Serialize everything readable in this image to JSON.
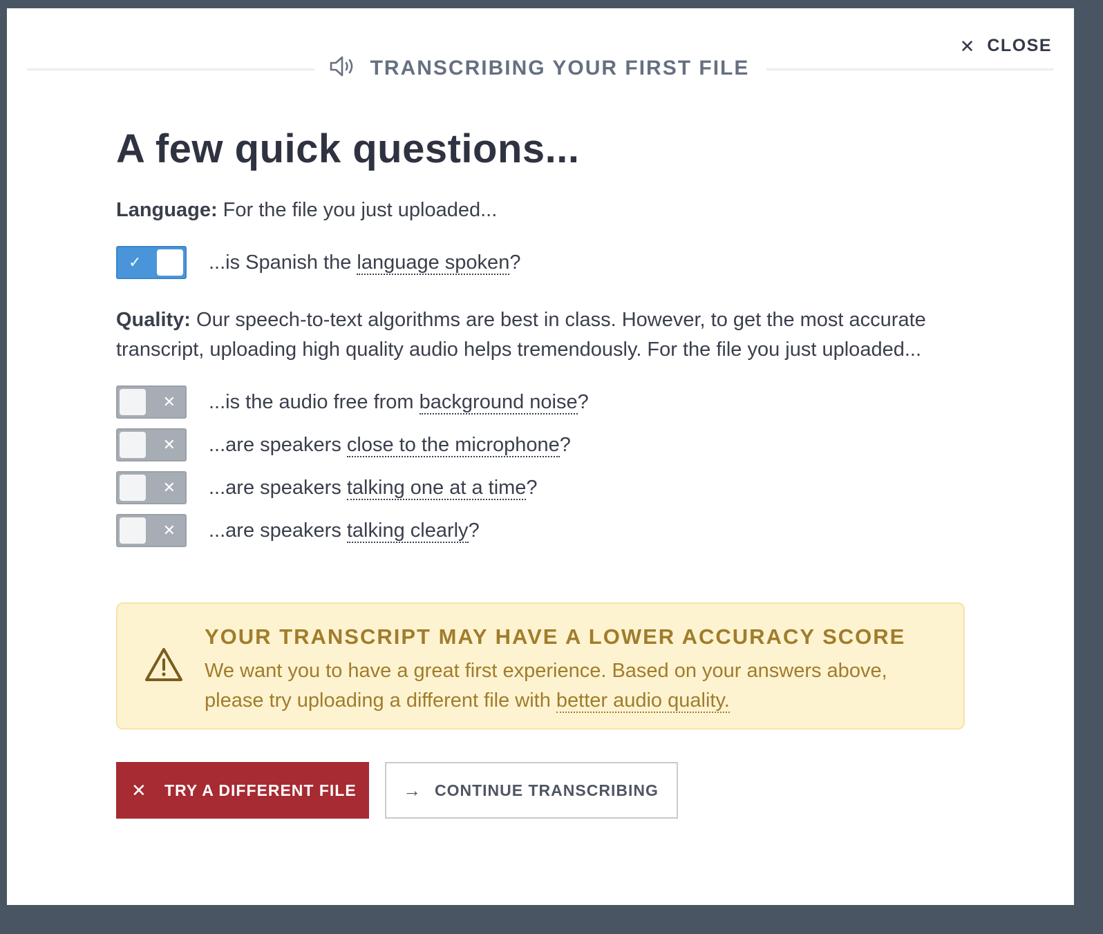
{
  "modal": {
    "close_label": "CLOSE",
    "header_title": "TRANSCRIBING YOUR FIRST FILE"
  },
  "content": {
    "heading": "A few quick questions...",
    "language": {
      "label": "Language:",
      "text": " For the file you just uploaded...",
      "question": {
        "prefix": "...is Spanish the ",
        "link": "language spoken",
        "suffix": "?",
        "checked": true
      }
    },
    "quality": {
      "label": "Quality:",
      "text": " Our speech-to-text algorithms are best in class. However, to get the most accurate transcript, uploading high quality audio helps tremendously. For the file you just uploaded...",
      "questions": [
        {
          "prefix": "...is the audio free from ",
          "link": "background noise",
          "suffix": "?",
          "checked": false
        },
        {
          "prefix": "...are speakers ",
          "link": "close to the microphone",
          "suffix": "?",
          "checked": false
        },
        {
          "prefix": "...are speakers ",
          "link": "talking one at a time",
          "suffix": "?",
          "checked": false
        },
        {
          "prefix": "...are speakers ",
          "link": "talking clearly",
          "suffix": "?",
          "checked": false
        }
      ]
    }
  },
  "alert": {
    "title": "YOUR TRANSCRIPT MAY HAVE A LOWER ACCURACY SCORE",
    "message": "We want you to have a great first experience. Based on your answers above, please try uploading a different file with ",
    "link": "better audio quality."
  },
  "buttons": {
    "try_different": "TRY A DIFFERENT FILE",
    "continue": "CONTINUE TRANSCRIBING"
  },
  "colors": {
    "accent_blue": "#4a95d9",
    "danger_red": "#a72b32",
    "warning_bg": "#fdf3d0",
    "warning_text": "#a07c2c"
  }
}
